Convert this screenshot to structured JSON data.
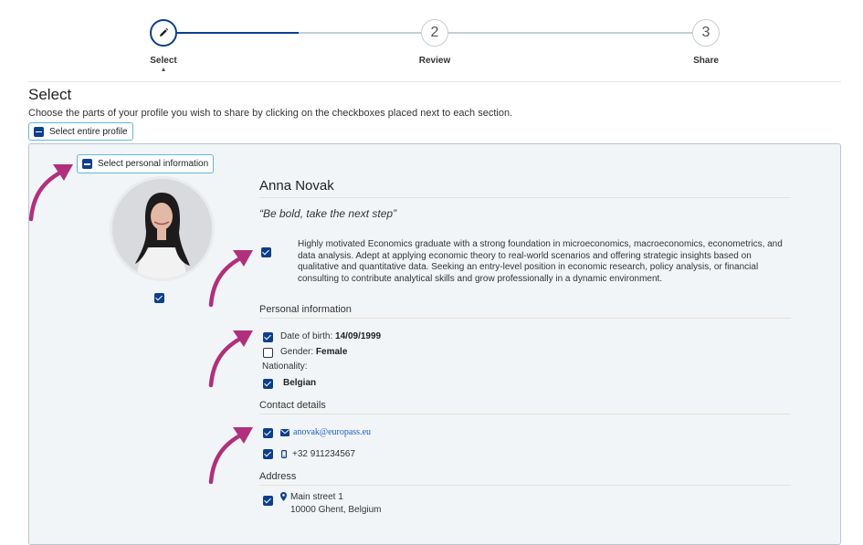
{
  "stepper": {
    "steps": [
      {
        "label": "Select",
        "icon": "pencil-icon"
      },
      {
        "label": "Review",
        "number": "2"
      },
      {
        "label": "Share",
        "number": "3"
      }
    ],
    "caret": "▲"
  },
  "page": {
    "title": "Select",
    "description": "Choose the parts of your profile you wish to share by clicking on the checkboxes placed next to each section.",
    "select_entire_profile": "Select entire profile"
  },
  "panel": {
    "select_personal_info": "Select personal information",
    "name": "Anna Novak",
    "quote": "“Be bold, take the next step”",
    "summary": "Highly motivated Economics graduate with a strong foundation in microeconomics, macroeconomics, econometrics, and data analysis. Adept at applying economic theory to real-world scenarios and offering strategic insights based on qualitative and quantitative data. Seeking an entry-level position in economic research, policy analysis, or financial consulting to contribute analytical skills and grow professionally in a dynamic environment.",
    "personal_information": {
      "title": "Personal information",
      "dob_label": "Date of birth:",
      "dob_value": "14/09/1999",
      "gender_label": "Gender:",
      "gender_value": "Female",
      "nationality_label": "Nationality:",
      "nationality_value": "Belgian"
    },
    "contact_details": {
      "title": "Contact details",
      "email": "anovak@europass.eu",
      "phone": "+32 911234567"
    },
    "address": {
      "title": "Address",
      "line1": "Main street 1",
      "line2": "10000 Ghent, Belgium"
    }
  },
  "colors": {
    "accent": "#0c3f8c",
    "pill_border": "#62b7e0",
    "arrow": "#b0307c",
    "panel_bg": "#f2f5f8"
  }
}
